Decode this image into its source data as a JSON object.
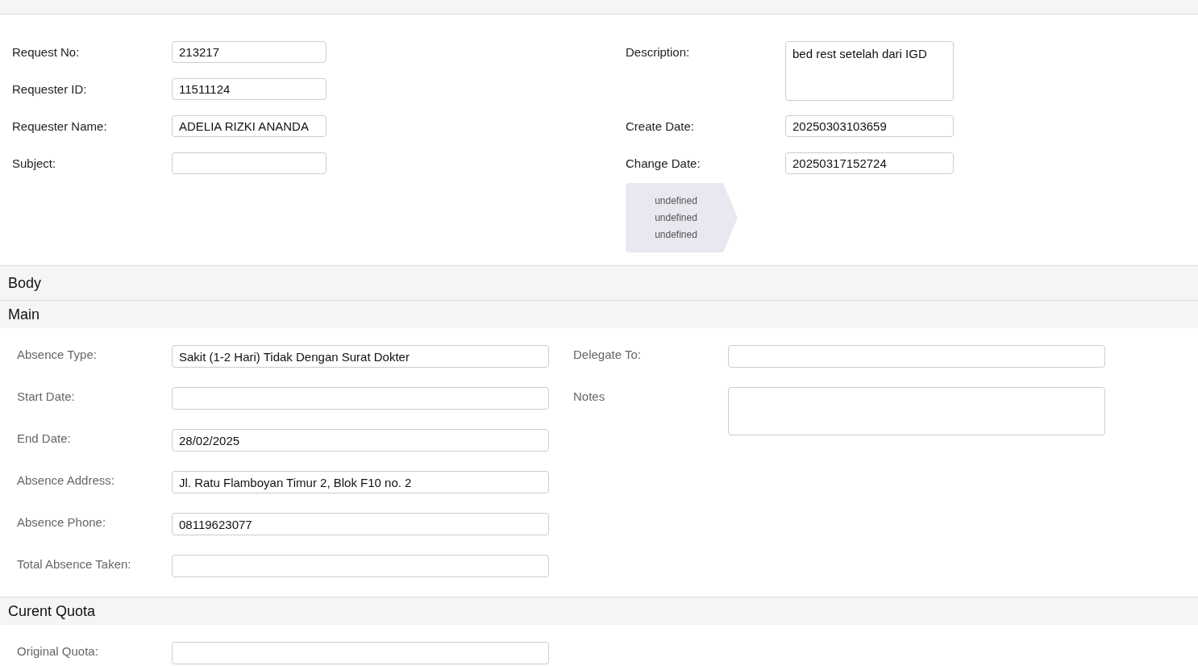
{
  "header": {
    "left_fields": [
      {
        "label": "Request No:",
        "value": "213217",
        "kind": "input"
      },
      {
        "label": "Requester ID:",
        "value": "11511124",
        "kind": "input"
      },
      {
        "label": "Requester Name:",
        "value": "ADELIA RIZKI ANANDA",
        "kind": "input"
      },
      {
        "label": "Subject:",
        "kind": "input"
      }
    ],
    "right_fields": [
      {
        "label": "Description:",
        "value": "bed rest setelah dari IGD",
        "kind": "textarea"
      },
      {
        "label": "Create Date:",
        "value": "20250303103659",
        "kind": "input"
      },
      {
        "label": "Change Date:",
        "value": "20250317152724",
        "kind": "input"
      }
    ],
    "status_tag": [
      "undefined",
      "undefined",
      "undefined"
    ]
  },
  "sections": [
    {
      "title": "Body"
    },
    {
      "title": "Main",
      "left_fields": [
        {
          "label": "Absence Type:",
          "value": "Sakit (1-2 Hari) Tidak Dengan Surat Dokter",
          "kind": "input"
        },
        {
          "label": "Start Date:",
          "kind": "input"
        },
        {
          "label": "End Date:",
          "value": "28/02/2025",
          "kind": "input"
        },
        {
          "label": "Absence Address:",
          "value": "Jl. Ratu Flamboyan Timur 2, Blok F10 no. 2",
          "kind": "input"
        },
        {
          "label": "Absence Phone:",
          "value": "08119623077",
          "kind": "input"
        },
        {
          "label": "Total Absence Taken:",
          "kind": "input"
        }
      ],
      "right_fields": [
        {
          "label": "Delegate To:",
          "kind": "input"
        },
        {
          "label": "Notes",
          "kind": "textarea"
        }
      ]
    },
    {
      "title": "Curent Quota",
      "left_fields": [
        {
          "label": "Original Quota:",
          "kind": "input"
        }
      ]
    }
  ]
}
